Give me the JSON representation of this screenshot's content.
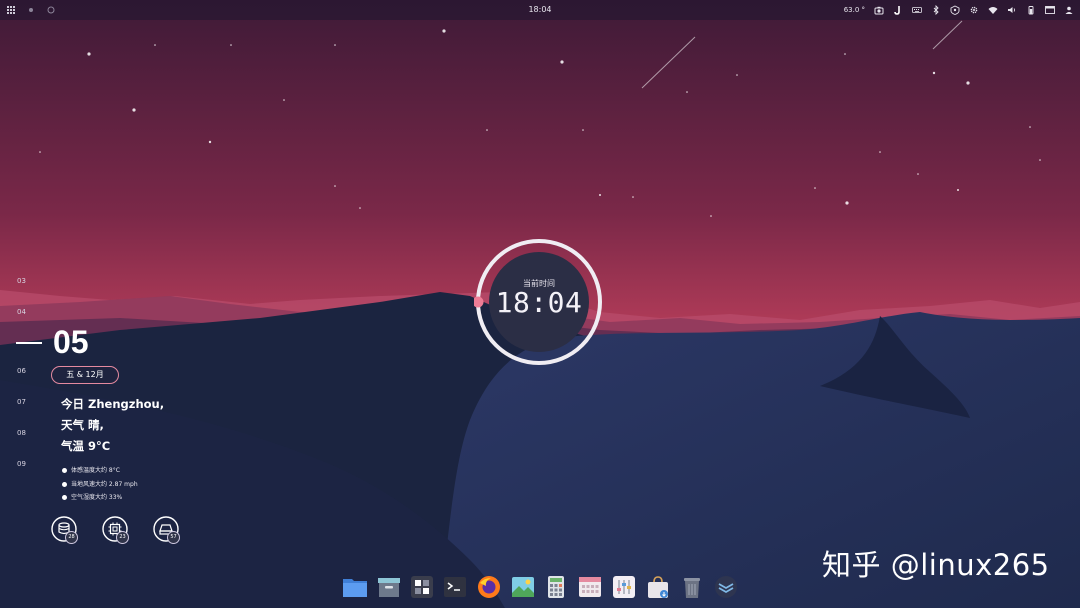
{
  "topbar": {
    "clock": "18:04",
    "temperature": "63.0 °",
    "left_icons": [
      "apps-grid-icon",
      "workspace-dot-icon",
      "workspace-ring-icon"
    ],
    "right_icons": [
      "screenshot-icon",
      "jetbrains-toolbox-icon",
      "keyboard-icon",
      "bluetooth-icon",
      "vpn-icon",
      "settings-gear-icon",
      "wifi-icon",
      "volume-icon",
      "battery-icon",
      "window-switcher-icon",
      "user-icon"
    ]
  },
  "clock_widget": {
    "label": "当前时间",
    "time": "18:04",
    "progress": 0.75,
    "accent": "#ee7d96"
  },
  "calendar": {
    "days_before": [
      "03",
      "04"
    ],
    "current_day": "05",
    "days_after": [
      "06",
      "07",
      "08",
      "09"
    ],
    "date_pill": "五 & 12月"
  },
  "weather": {
    "line1": "今日 Zhengzhou,",
    "line2": "天气 晴,",
    "line3": "气温 9°C",
    "details": [
      "体感温度大约 8°C",
      "当地风速大约 2.87 mph",
      "空气湿度大约 33%"
    ]
  },
  "meters": [
    {
      "icon": "disk-icon",
      "value": "28"
    },
    {
      "icon": "cpu-icon",
      "value": "23"
    },
    {
      "icon": "memory-icon",
      "value": "57"
    }
  ],
  "dock": [
    {
      "name": "dock-files",
      "icon": "folder-icon"
    },
    {
      "name": "dock-archive",
      "icon": "archive-icon"
    },
    {
      "name": "dock-workspaces",
      "icon": "workspaces-icon"
    },
    {
      "name": "dock-terminal",
      "icon": "terminal-icon"
    },
    {
      "name": "dock-firefox",
      "icon": "firefox-icon"
    },
    {
      "name": "dock-image-viewer",
      "icon": "image-icon"
    },
    {
      "name": "dock-calculator",
      "icon": "calculator-icon"
    },
    {
      "name": "dock-calendar",
      "icon": "calendar-icon"
    },
    {
      "name": "dock-settings",
      "icon": "sliders-icon"
    },
    {
      "name": "dock-store",
      "icon": "store-bag-icon"
    },
    {
      "name": "dock-trash",
      "icon": "trash-icon"
    },
    {
      "name": "dock-app",
      "icon": "layers-icon"
    }
  ],
  "watermark": "知乎 @linux265",
  "colors": {
    "sky_top": "#4a1f3c",
    "sky_bottom": "#d84e6e",
    "dune_dark": "#1c2540",
    "dune_light": "#2a3763",
    "accent_pink": "#ee7d96"
  }
}
